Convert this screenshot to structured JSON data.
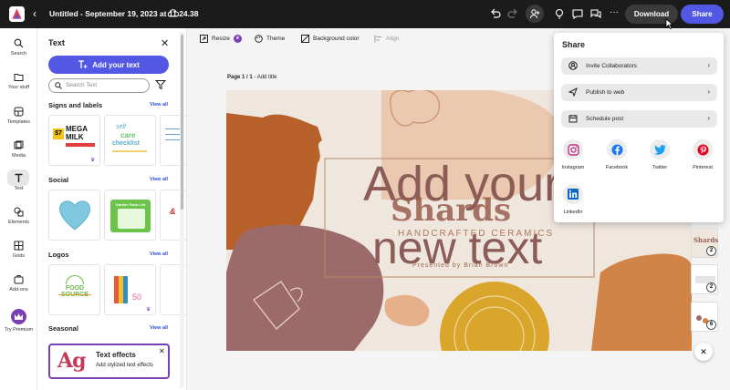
{
  "app": {
    "document_title": "Untitled - September 19, 2023 at 11.24.38",
    "download_label": "Download",
    "share_label": "Share"
  },
  "rail": [
    {
      "label": "Search",
      "icon": "search-icon"
    },
    {
      "label": "Your stuff",
      "icon": "folder-icon"
    },
    {
      "label": "Templates",
      "icon": "templates-icon"
    },
    {
      "label": "Media",
      "icon": "media-icon"
    },
    {
      "label": "Text",
      "icon": "text-icon",
      "active": true
    },
    {
      "label": "Elements",
      "icon": "elements-icon"
    },
    {
      "label": "Grids",
      "icon": "grids-icon"
    },
    {
      "label": "Add-ons",
      "icon": "addons-icon"
    },
    {
      "label": "Try Premium",
      "icon": "crown-icon"
    }
  ],
  "panel": {
    "title": "Text",
    "add_text": "Add your text",
    "search_placeholder": "Search Text",
    "sections": [
      {
        "label": "Signs and labels",
        "view_all": "View all"
      },
      {
        "label": "Social",
        "view_all": "View all"
      },
      {
        "label": "Logos",
        "view_all": "View all"
      },
      {
        "label": "Seasonal",
        "view_all": "View all"
      }
    ],
    "thumb_texts": {
      "sign1": "MEGA MILK",
      "sign1_price": "$7",
      "sign2a": "self",
      "sign2b": "care",
      "sign2c": "checklist",
      "social2": "Garden Pack List",
      "logo1": "FOOD SOURCE",
      "logo2": "50"
    },
    "effects_title": "Text effects",
    "effects_desc": "Add stylized text effects",
    "effects_glyph": "Ag"
  },
  "toolbar": {
    "resize": "Resize",
    "theme": "Theme",
    "background_color": "Background color",
    "align": "Align"
  },
  "page": {
    "label_bold": "Page 1 / 1",
    "label_rest": " - Add title"
  },
  "canvas": {
    "headline_line1": "Add your",
    "headline_line2": "new text",
    "brand": "Shards",
    "tagline": "HANDCRAFTED CERAMICS",
    "presented": "Presented by Brian Brown"
  },
  "share_popover": {
    "title": "Share",
    "rows": [
      {
        "label": "Invite Collaborators",
        "icon": "person-add-icon"
      },
      {
        "label": "Publish to web",
        "icon": "send-icon"
      },
      {
        "label": "Schedule post",
        "icon": "calendar-icon"
      }
    ],
    "socials": [
      {
        "label": "Instagram",
        "icon": "instagram-icon",
        "color": "#c13584"
      },
      {
        "label": "Facebook",
        "icon": "facebook-icon",
        "color": "#1877f2"
      },
      {
        "label": "Twitter",
        "icon": "twitter-icon",
        "color": "#1da1f2"
      },
      {
        "label": "Pinterest",
        "icon": "pinterest-icon",
        "color": "#e60023"
      },
      {
        "label": "LinkedIn",
        "icon": "linkedin-icon",
        "color": "#0a66c2"
      }
    ]
  },
  "page_thumbs": [
    {
      "badge": "2",
      "text": "Shards"
    },
    {
      "badge": "2"
    },
    {
      "badge": "6"
    }
  ],
  "colors": {
    "accent": "#5258e4",
    "topbar": "#1b1b1b",
    "canvas_bg": "#efe6de",
    "premium": "#7b3fb5"
  }
}
